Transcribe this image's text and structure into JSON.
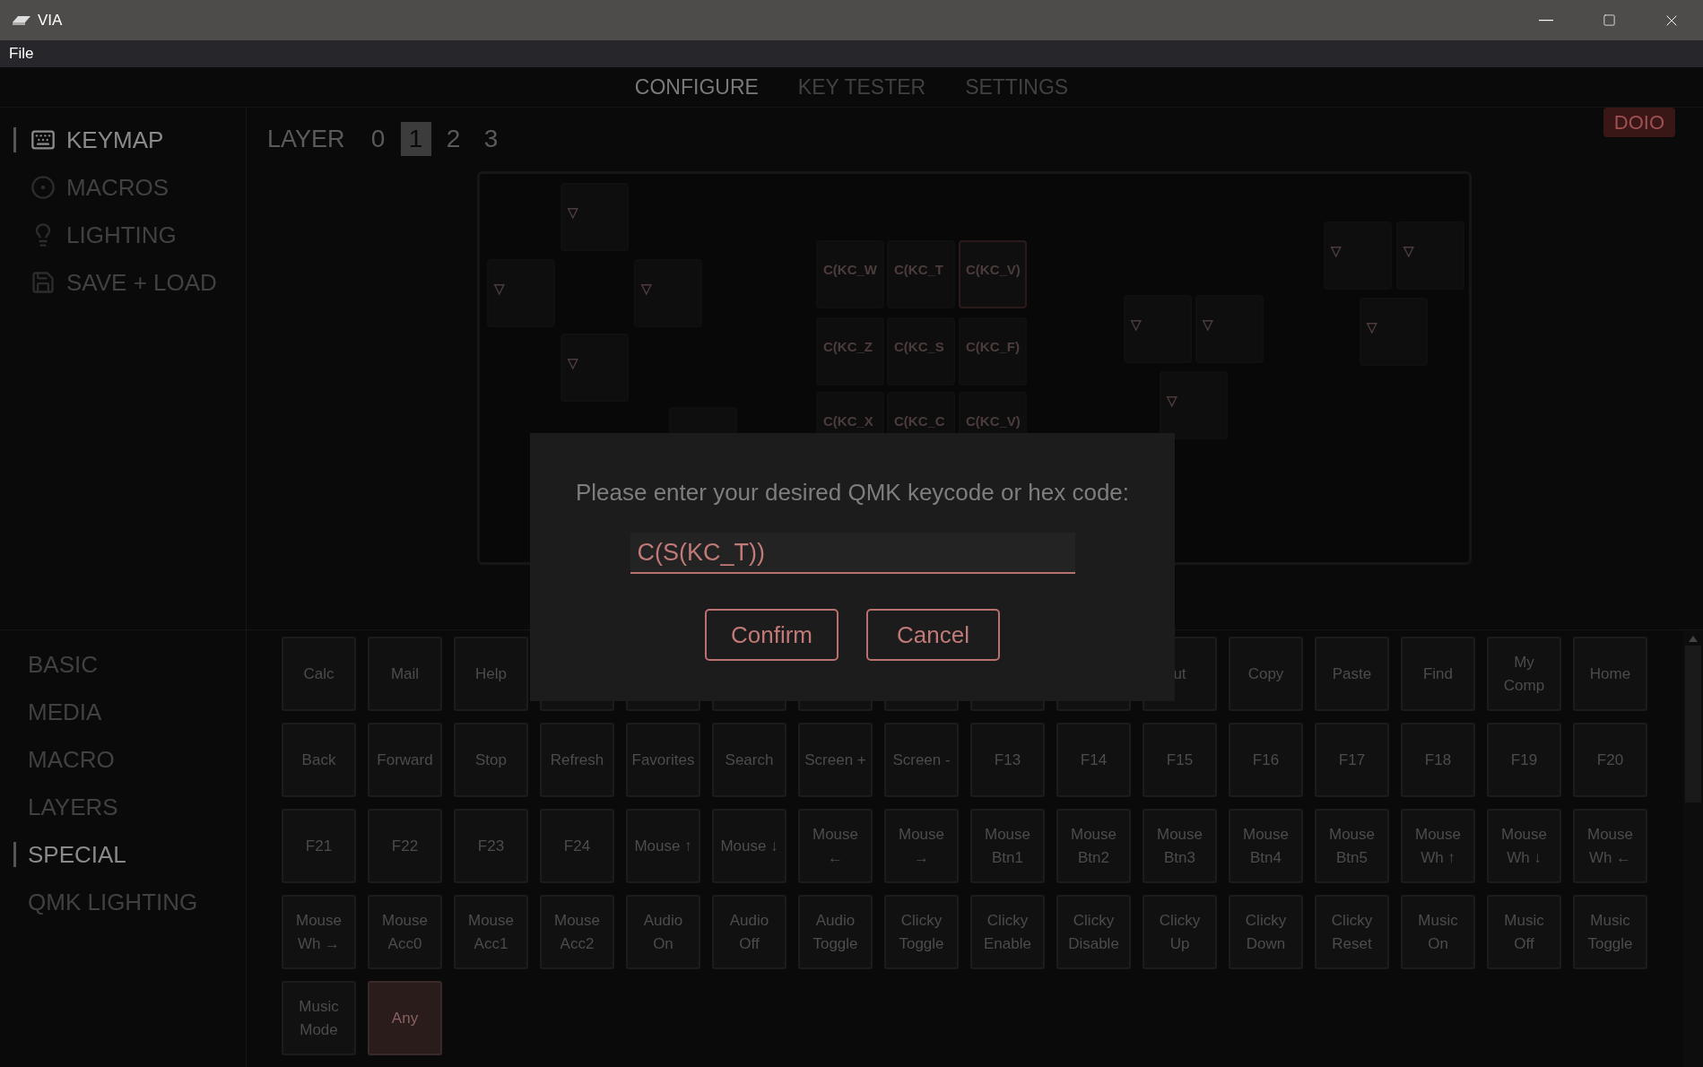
{
  "window": {
    "title": "VIA"
  },
  "menu": [
    "File"
  ],
  "nav_tabs": [
    {
      "label": "CONFIGURE",
      "selected": true
    },
    {
      "label": "KEY TESTER",
      "selected": false
    },
    {
      "label": "SETTINGS",
      "selected": false
    }
  ],
  "sidebar": {
    "items": [
      {
        "label": "KEYMAP",
        "kind": "keyboard",
        "selected": true
      },
      {
        "label": "MACROS",
        "kind": "macro",
        "selected": false
      },
      {
        "label": "LIGHTING",
        "kind": "bulb",
        "selected": false
      },
      {
        "label": "SAVE + LOAD",
        "kind": "disk",
        "selected": false
      }
    ]
  },
  "layer": {
    "label": "LAYER",
    "layers": [
      {
        "label": "0",
        "selected": false
      },
      {
        "label": "1",
        "selected": true
      },
      {
        "label": "2",
        "selected": false
      },
      {
        "label": "3",
        "selected": false
      }
    ]
  },
  "device_badge": "DOIO",
  "keyboard": {
    "keys": [
      {
        "label": "▽",
        "selected": false
      },
      {
        "label": "▽",
        "selected": false
      },
      {
        "label": "▽",
        "selected": false
      },
      {
        "label": "▽",
        "selected": false
      },
      {
        "selected": false
      },
      {
        "label": "C(KC_W",
        "selected": false
      },
      {
        "label": "C(KC_T",
        "selected": false
      },
      {
        "label": "C(KC_V)",
        "selected": true
      },
      {
        "label": "C(KC_Z",
        "selected": false
      },
      {
        "label": "C(KC_S",
        "selected": false
      },
      {
        "label": "C(KC_F)",
        "selected": false
      },
      {
        "label": "C(KC_X",
        "selected": false
      },
      {
        "label": "C(KC_C",
        "selected": false
      },
      {
        "label": "C(KC_V)",
        "selected": false
      },
      {
        "label": "▽",
        "selected": false
      },
      {
        "label": "▽",
        "selected": false
      },
      {
        "label": "▽",
        "selected": false
      },
      {
        "label": "▽",
        "selected": false
      },
      {
        "label": "▽",
        "selected": false
      },
      {
        "label": "▽",
        "selected": false
      }
    ]
  },
  "keycode_categories": [
    {
      "label": "BASIC",
      "selected": false
    },
    {
      "label": "MEDIA",
      "selected": false
    },
    {
      "label": "MACRO",
      "selected": false
    },
    {
      "label": "LAYERS",
      "selected": false
    },
    {
      "label": "SPECIAL",
      "selected": true
    },
    {
      "label": "QMK LIGHTING",
      "selected": false
    }
  ],
  "keycodes": [
    {
      "label": "Calc",
      "selected": false
    },
    {
      "label": "Mail",
      "selected": false
    },
    {
      "label": "Help",
      "selected": false
    },
    {
      "selected": false
    },
    {
      "selected": false
    },
    {
      "selected": false
    },
    {
      "selected": false
    },
    {
      "selected": false
    },
    {
      "selected": false
    },
    {
      "selected": false
    },
    {
      "label": "ut",
      "selected": false
    },
    {
      "label": "Copy",
      "selected": false
    },
    {
      "label": "Paste",
      "selected": false
    },
    {
      "label": "Find",
      "selected": false
    },
    {
      "label": "My\nComp",
      "selected": false
    },
    {
      "label": "Home",
      "selected": false
    },
    {
      "label": "Back",
      "selected": false
    },
    {
      "label": "Forward",
      "selected": false
    },
    {
      "label": "Stop",
      "selected": false
    },
    {
      "label": "Refresh",
      "selected": false
    },
    {
      "label": "Favorites",
      "selected": false
    },
    {
      "label": "Search",
      "selected": false
    },
    {
      "label": "Screen +",
      "selected": false
    },
    {
      "label": "Screen -",
      "selected": false
    },
    {
      "label": "F13",
      "selected": false
    },
    {
      "label": "F14",
      "selected": false
    },
    {
      "label": "F15",
      "selected": false
    },
    {
      "label": "F16",
      "selected": false
    },
    {
      "label": "F17",
      "selected": false
    },
    {
      "label": "F18",
      "selected": false
    },
    {
      "label": "F19",
      "selected": false
    },
    {
      "label": "F20",
      "selected": false
    },
    {
      "label": "F21",
      "selected": false
    },
    {
      "label": "F22",
      "selected": false
    },
    {
      "label": "F23",
      "selected": false
    },
    {
      "label": "F24",
      "selected": false
    },
    {
      "label": "Mouse ↑",
      "selected": false
    },
    {
      "label": "Mouse ↓",
      "selected": false
    },
    {
      "label": "Mouse\n←",
      "selected": false
    },
    {
      "label": "Mouse\n→",
      "selected": false
    },
    {
      "label": "Mouse\nBtn1",
      "selected": false
    },
    {
      "label": "Mouse\nBtn2",
      "selected": false
    },
    {
      "label": "Mouse\nBtn3",
      "selected": false
    },
    {
      "label": "Mouse\nBtn4",
      "selected": false
    },
    {
      "label": "Mouse\nBtn5",
      "selected": false
    },
    {
      "label": "Mouse\nWh ↑",
      "selected": false
    },
    {
      "label": "Mouse\nWh ↓",
      "selected": false
    },
    {
      "label": "Mouse\nWh ←",
      "selected": false
    },
    {
      "label": "Mouse\nWh →",
      "selected": false
    },
    {
      "label": "Mouse\nAcc0",
      "selected": false
    },
    {
      "label": "Mouse\nAcc1",
      "selected": false
    },
    {
      "label": "Mouse\nAcc2",
      "selected": false
    },
    {
      "label": "Audio\nOn",
      "selected": false
    },
    {
      "label": "Audio\nOff",
      "selected": false
    },
    {
      "label": "Audio\nToggle",
      "selected": false
    },
    {
      "label": "Clicky\nToggle",
      "selected": false
    },
    {
      "label": "Clicky\nEnable",
      "selected": false
    },
    {
      "label": "Clicky\nDisable",
      "selected": false
    },
    {
      "label": "Clicky\nUp",
      "selected": false
    },
    {
      "label": "Clicky\nDown",
      "selected": false
    },
    {
      "label": "Clicky\nReset",
      "selected": false
    },
    {
      "label": "Music\nOn",
      "selected": false
    },
    {
      "label": "Music\nOff",
      "selected": false
    },
    {
      "label": "Music\nToggle",
      "selected": false
    },
    {
      "label": "Music\nMode",
      "selected": false
    },
    {
      "label": "Any",
      "selected": true
    }
  ],
  "dialog": {
    "prompt": "Please enter your desired QMK keycode or hex code:",
    "value": "C(S(KC_T))",
    "buttons": [
      "Confirm",
      "Cancel"
    ]
  }
}
